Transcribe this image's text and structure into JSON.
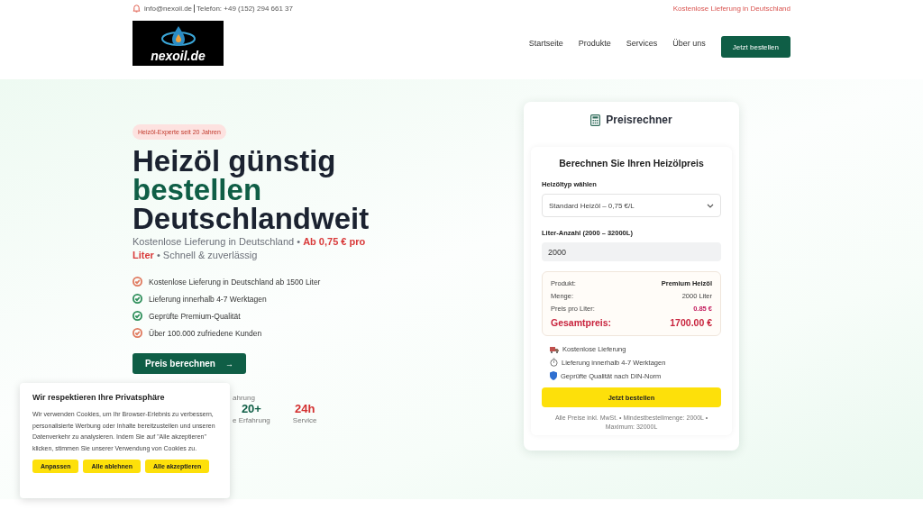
{
  "topbar": {
    "email": "info@nexoil.de",
    "phone": "Telefon: +49 (152) 294 661 37",
    "promo": "Kostenlose Lieferung in Deutschland"
  },
  "logo": {
    "text": "nexoil.de"
  },
  "nav": {
    "items": [
      "Startseite",
      "Produkte",
      "Services",
      "Über uns"
    ],
    "cta": "Jetzt bestellen"
  },
  "hero": {
    "badge": "Heizöl-Experte seit 20 Jahren",
    "title_lines": [
      {
        "text": "Heizöl günstig",
        "accent": false
      },
      {
        "text": "bestellen",
        "accent": true
      },
      {
        "text": "Deutschlandweit",
        "accent": false
      }
    ],
    "subtitle": "Kostenlose Lieferung in Deutschland • **Ab 0,75 € pro Liter** • Schnell & zuverlässig",
    "features": [
      {
        "text": "Kostenlose Lieferung in Deutschland ab 1500 Liter",
        "color": "#e07a5f"
      },
      {
        "text": "Lieferung innerhalb 4-7 Werktagen",
        "color": "#2f8f5b"
      },
      {
        "text": "Geprüfte Premium-Qualität",
        "color": "#2f8f5b"
      },
      {
        "text": "Über 100.000 zufriedene Kunden",
        "color": "#e07a5f"
      }
    ],
    "button": "Preis berechnen",
    "button_icon": "→",
    "stats_note": "ahrung",
    "stats": [
      {
        "value": "20+",
        "label": "e Erfahrung",
        "color": "#0f5e46"
      },
      {
        "value": "24h",
        "label": "Service",
        "color": "#d32f2f"
      }
    ]
  },
  "calculator": {
    "title": "Preisrechner",
    "heading": "Berechnen Sie Ihren Heizölpreis",
    "type_label": "Heizöltyp wählen",
    "type_value": "Standard Heizöl – 0,75 €/L",
    "liter_label": "Liter-Anzahl (2000 – 32000L)",
    "liter_value": "2000",
    "summary": [
      {
        "label": "Produkt:",
        "value": "Premium Heizöl",
        "kind": "bold"
      },
      {
        "label": "Menge:",
        "value": "2000 Liter",
        "kind": "plain"
      },
      {
        "label": "Preis pro Liter:",
        "value": "0.85 €",
        "kind": "price"
      },
      {
        "label": "Gesamtpreis:",
        "value": "1700.00 €",
        "kind": "total"
      }
    ],
    "perks": [
      {
        "text": "Kostenlose Lieferung",
        "kind": "truck"
      },
      {
        "text": "Lieferung innerhalb 4-7 Werktagen",
        "kind": "timer"
      },
      {
        "text": "Geprüfte Qualität nach DIN-Norm",
        "kind": "shield"
      }
    ],
    "order_button": "Jetzt bestellen",
    "footnote": "Alle Preise inkl. MwSt. • Mindestbestellmenge: 2000L • Maximum: 32000L"
  },
  "cookie": {
    "title": "Wir respektieren Ihre Privatsphäre",
    "text": "Wir verwenden Cookies, um Ihr Browser-Erlebnis zu verbessern, personalisierte Werbung oder Inhalte bereitzustellen und unseren Datenverkehr zu analysieren. Indem Sie auf \"Alle akzeptieren\" klicken, stimmen Sie unserer Verwendung von Cookies zu.",
    "buttons": [
      "Anpassen",
      "Alle ablehnen",
      "Alle akzeptieren"
    ]
  }
}
